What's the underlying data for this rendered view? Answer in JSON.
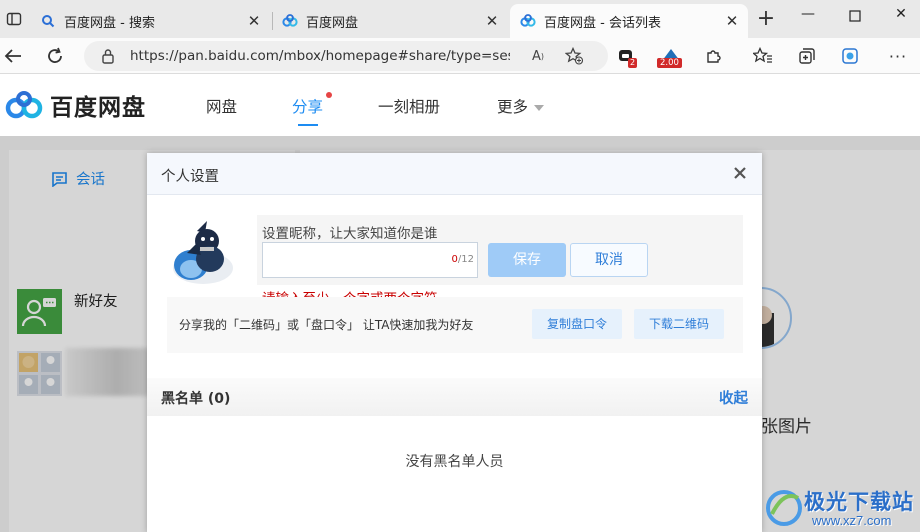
{
  "browser": {
    "tabs": [
      {
        "title": "百度网盘 - 搜索",
        "icon": "search-icon",
        "active": false
      },
      {
        "title": "百度网盘",
        "icon": "baidu-netdisk-icon",
        "active": false
      },
      {
        "title": "百度网盘 - 会话列表",
        "icon": "baidu-netdisk-icon",
        "active": true
      }
    ],
    "url": "https://pan.baidu.com/mbox/homepage#share/type=session",
    "extensions": [
      {
        "name": "extension-icon",
        "badge": "2"
      },
      {
        "name": "speed-extension-icon",
        "badge": "2.00"
      }
    ]
  },
  "site": {
    "logo_text": "百度网盘",
    "nav": [
      {
        "label": "网盘",
        "active": false
      },
      {
        "label": "分享",
        "active": true,
        "has_dot": true
      },
      {
        "label": "一刻相册",
        "active": false
      },
      {
        "label": "更多",
        "active": false,
        "has_caret": true
      }
    ]
  },
  "sidebar": {
    "tab_label": "会话",
    "conversations": [
      {
        "name": "新好友"
      },
      {
        "name": ""
      }
    ]
  },
  "main": {
    "partial_text": "张图片"
  },
  "modal": {
    "title": "个人设置",
    "nickname_hint": "设置昵称，让大家知道你是谁",
    "nickname_value": "",
    "count_current": "0",
    "count_max": "/12",
    "save_label": "保存",
    "cancel_label": "取消",
    "error_text": "请输入至少一个字或两个字符",
    "share_text": "分享我的「二维码」或「盘口令」 让TA快速加我为好友",
    "copy_label": "复制盘口令",
    "download_label": "下载二维码",
    "blacklist_title": "黑名单 (0)",
    "blacklist_toggle": "收起",
    "blacklist_empty": "没有黑名单人员"
  },
  "watermark": {
    "text": "极光下载站",
    "sub": "www.xz7.com"
  },
  "colors": {
    "accent": "#1d8cf2",
    "error": "#c80000",
    "save_disabled": "#9fcbf7"
  }
}
